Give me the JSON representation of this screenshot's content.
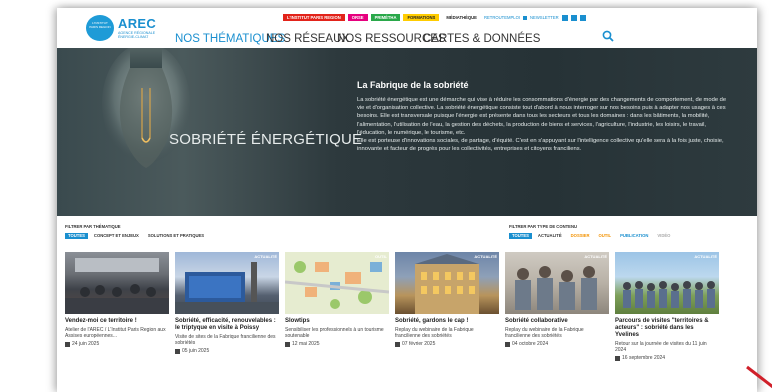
{
  "header": {
    "logo_badge": "L'INSTITUT PARIS REGION",
    "logo_title": "AREC",
    "logo_sub": "AGENCE RÉGIONALE ÉNERGIE-CLIMAT",
    "top_pills": [
      {
        "label": "L'INSTITUT PARIS REGION",
        "color": "#e2231a"
      },
      {
        "label": "ORSE",
        "color": "#e6007e"
      },
      {
        "label": "PRIMÉTHA",
        "color": "#2aa84a"
      },
      {
        "label": "FORMATIONS",
        "color": "#ffcc00"
      },
      {
        "label": "MÉDIATHÈQUE",
        "color": "#ffffff"
      }
    ],
    "top_links": [
      "RETROUTEMPLOI",
      "NEWSLETTER"
    ],
    "nav": [
      "NOS THÉMATIQUES",
      "NOS RÉSEAUX",
      "NOS RESSOURCES",
      "CARTES & DONNÉES"
    ],
    "search_icon": "search-icon"
  },
  "hero": {
    "title": "SOBRIÉTÉ ÉNERGÉTIQUE",
    "heading": "La Fabrique de la sobriété",
    "body": "La sobriété énergétique est une démarche qui vise à réduire les consommations d'énergie par des changements de comportement, de mode de vie et d'organisation collective. La sobriété énergétique consiste tout d'abord à nous interroger sur nos besoins puis à adapter nos usages à ces besoins. Elle est transversale puisque l'énergie est présente dans tous les secteurs et tous les domaines : dans les bâtiments, la mobilité, l'alimentation, l'utilisation de l'eau, la gestion des déchets, la production de biens et services, l'agriculture, l'industrie, les loisirs, le travail, l'éducation, le numérique, le tourisme, etc.",
    "body2": "Elle est porteuse d'innovations sociales, de partage, d'équité. C'est en s'appuyant sur l'intelligence collective qu'elle sera à la fois juste, choisie, innovante et facteur de progrès pour les collectivités, entreprises et citoyens franciliens."
  },
  "filters": {
    "theme_label": "FILTRER PAR THÉMATIQUE",
    "theme_chips": [
      "TOUTES",
      "CONCEPT ET ENJEUX",
      "SOLUTIONS ET PRATIQUES"
    ],
    "type_label": "FILTRER PAR TYPE DE CONTENU",
    "type_chips": [
      "TOUTES",
      "ACTUALITÉ",
      "DOSSIER",
      "OUTIL",
      "PUBLICATION",
      "VIDÉO"
    ]
  },
  "cards": [
    {
      "tag": "",
      "title": "Vendez-moi ce territoire !",
      "desc": "Atelier de l'AREC / L'Institut Paris Region aux Assises européennes...",
      "date": "24 juin 2025"
    },
    {
      "tag": "ACTUALITÉ",
      "title": "Sobriété, efficacité, renouvelables : le triptyque en visite à Poissy",
      "desc": "Visite de sites de la Fabrique francilienne des sobriétés",
      "date": "05 juin 2025"
    },
    {
      "tag": "OUTIL",
      "title": "Slowtips",
      "desc": "Sensibiliser les professionnels à un tourisme soutenable",
      "date": "12 mai 2025"
    },
    {
      "tag": "ACTUALITÉ",
      "title": "Sobriété, gardons le cap !",
      "desc": "Replay du webinaire de la Fabrique francilienne des sobriétés",
      "date": "07 février 2025"
    },
    {
      "tag": "ACTUALITÉ",
      "title": "Sobriété collaborative",
      "desc": "Replay du webinaire de la Fabrique francilienne des sobriétés",
      "date": "04 octobre 2024"
    },
    {
      "tag": "ACTUALITÉ",
      "title": "Parcours de visites \"territoires & acteurs\" : sobriété dans les Yvelines",
      "desc": "Retour sur la journée de visites du 11 juin 2024",
      "date": "16 septembre 2024"
    }
  ]
}
